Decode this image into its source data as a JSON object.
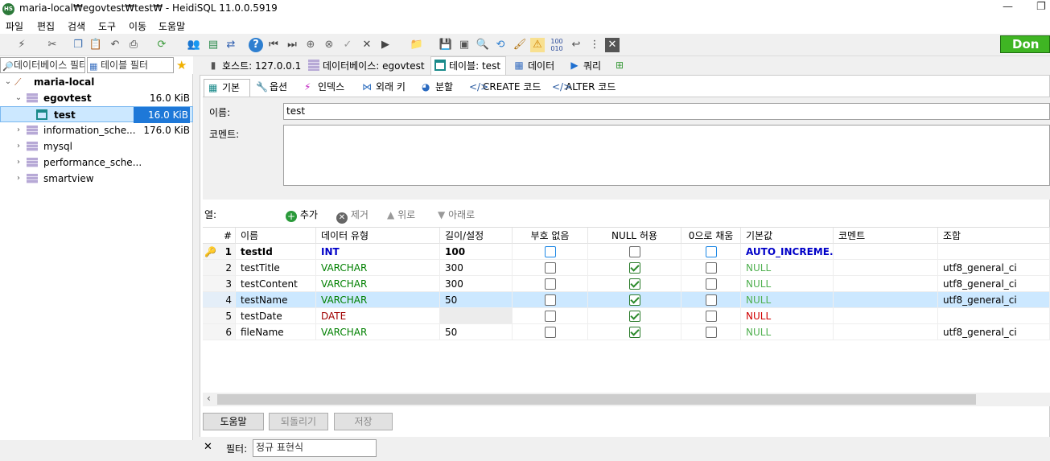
{
  "window": {
    "title": "maria-local₩egovtest₩test₩ - HeidiSQL 11.0.0.5919",
    "app_icon": "HS"
  },
  "menu": [
    "파일",
    "편집",
    "검색",
    "도구",
    "이동",
    "도움말"
  ],
  "toolbar": {
    "done_label": "Don"
  },
  "filters": {
    "db_filter_placeholder": "데이터베이스 필터",
    "table_filter_placeholder": "테이블 필터"
  },
  "tree": {
    "root": "maria-local",
    "nodes": [
      {
        "label": "egovtest",
        "size": "16.0 KiB"
      },
      {
        "label": "test",
        "size": "16.0 KiB"
      },
      {
        "label": "information_sche...",
        "size": "176.0 KiB"
      },
      {
        "label": "mysql",
        "size": ""
      },
      {
        "label": "performance_sche...",
        "size": ""
      },
      {
        "label": "smartview",
        "size": ""
      }
    ]
  },
  "main_tabs": [
    "호스트: 127.0.0.1",
    "데이터베이스: egovtest",
    "테이블: test",
    "데이터",
    "쿼리"
  ],
  "sub_tabs": [
    "기본",
    "옵션",
    "인덱스",
    "외래 키",
    "분할",
    "CREATE 코드",
    "ALTER 코드"
  ],
  "form": {
    "name_label": "이름:",
    "name_value": "test",
    "comment_label": "코멘트:",
    "comment_value": ""
  },
  "columns_bar": {
    "label": "열:",
    "add": "추가",
    "remove": "제거",
    "up": "위로",
    "down": "아래로"
  },
  "grid": {
    "headers": [
      "#",
      "이름",
      "데이터 유형",
      "길이/설정",
      "부호 없음",
      "NULL 허용",
      "0으로 채움",
      "기본값",
      "코멘트",
      "조합"
    ],
    "rows": [
      {
        "n": "1",
        "name": "testId",
        "type": "INT",
        "length": "100",
        "unsigned": false,
        "nullable": false,
        "zerofill": false,
        "default": "AUTO_INCREME...",
        "comment": "",
        "collation": ""
      },
      {
        "n": "2",
        "name": "testTitle",
        "type": "VARCHAR",
        "length": "300",
        "unsigned": false,
        "nullable": true,
        "zerofill": false,
        "default": "NULL",
        "comment": "",
        "collation": "utf8_general_ci"
      },
      {
        "n": "3",
        "name": "testContent",
        "type": "VARCHAR",
        "length": "300",
        "unsigned": false,
        "nullable": true,
        "zerofill": false,
        "default": "NULL",
        "comment": "",
        "collation": "utf8_general_ci"
      },
      {
        "n": "4",
        "name": "testName",
        "type": "VARCHAR",
        "length": "50",
        "unsigned": false,
        "nullable": true,
        "zerofill": false,
        "default": "NULL",
        "comment": "",
        "collation": "utf8_general_ci"
      },
      {
        "n": "5",
        "name": "testDate",
        "type": "DATE",
        "length": "",
        "unsigned": false,
        "nullable": true,
        "zerofill": false,
        "default": "NULL",
        "comment": "",
        "collation": ""
      },
      {
        "n": "6",
        "name": "fileName",
        "type": "VARCHAR",
        "length": "50",
        "unsigned": false,
        "nullable": true,
        "zerofill": false,
        "default": "NULL",
        "comment": "",
        "collation": "utf8_general_ci"
      }
    ]
  },
  "buttons": {
    "help": "도움말",
    "discard": "되돌리기",
    "save": "저장"
  },
  "bottom": {
    "filter_label": "필터:",
    "filter_value": "정규 표현식"
  },
  "colors": {
    "int_type": "#0000c8",
    "varchar_type": "#008000",
    "date_type": "#a00000",
    "null_green": "#50b050",
    "null_red": "#d00000",
    "auto_inc": "#0000c8",
    "selection": "#cce8ff"
  }
}
